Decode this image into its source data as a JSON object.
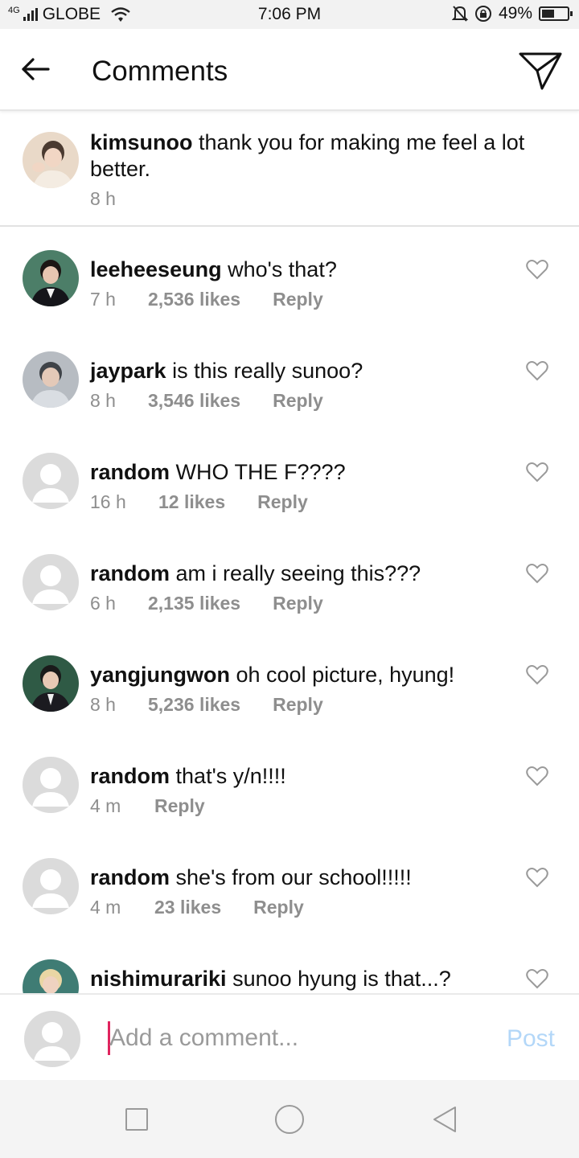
{
  "status_bar": {
    "network": "4G",
    "carrier": "GLOBE",
    "time": "7:06 PM",
    "battery": "49%",
    "battery_level": 0.49
  },
  "header": {
    "title": "Comments",
    "back_icon": "arrow-left-icon",
    "send_icon": "paper-plane-icon"
  },
  "caption": {
    "username": "kimsunoo",
    "text": "thank you for making me feel a lot better.",
    "time": "8 h"
  },
  "comments": [
    {
      "username": "leeheeseung",
      "text": "who's that?",
      "time": "7 h",
      "likes": "2,536 likes",
      "reply": "Reply",
      "avatar": "photo-green"
    },
    {
      "username": "jaypark",
      "text": "is this really sunoo?",
      "time": "8 h",
      "likes": "3,546 likes",
      "reply": "Reply",
      "avatar": "photo-grey"
    },
    {
      "username": "random",
      "text": "WHO THE F????",
      "time": "16 h",
      "likes": "12 likes",
      "reply": "Reply",
      "avatar": "placeholder"
    },
    {
      "username": "random",
      "text": "am i really seeing this???",
      "time": "6 h",
      "likes": "2,135 likes",
      "reply": "Reply",
      "avatar": "placeholder"
    },
    {
      "username": "yangjungwon",
      "text": "oh cool picture, hyung!",
      "time": "8 h",
      "likes": "5,236 likes",
      "reply": "Reply",
      "avatar": "photo-dark-green"
    },
    {
      "username": "random",
      "text": "that's y/n!!!!",
      "time": "4 m",
      "likes": "",
      "reply": "Reply",
      "avatar": "placeholder"
    },
    {
      "username": "random",
      "text": "she's from our school!!!!!",
      "time": "4 m",
      "likes": "23 likes",
      "reply": "Reply",
      "avatar": "placeholder"
    },
    {
      "username": "nishimurariki",
      "text": "sunoo hyung is that...?",
      "time": "",
      "likes": "",
      "reply": "",
      "avatar": "photo-teal"
    }
  ],
  "composer": {
    "placeholder": "Add a comment...",
    "post_label": "Post"
  },
  "colors": {
    "post_disabled": "#b3d7f8",
    "cursor": "#e0245e",
    "meta_grey": "#8e8e8e"
  },
  "nav_bar": {
    "icons": [
      "recent-apps-icon",
      "home-icon",
      "back-triangle-icon"
    ]
  }
}
